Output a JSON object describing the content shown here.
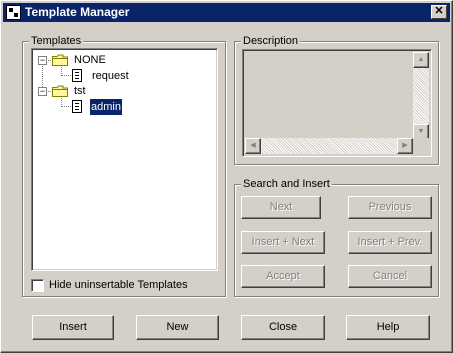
{
  "window": {
    "title": "Template Manager",
    "close_glyph": "✕",
    "icon": "template-manager-icon"
  },
  "templates": {
    "group_label": "Templates",
    "tree": [
      {
        "label": "NONE",
        "type": "folder",
        "expanded": true,
        "children": [
          {
            "label": "request",
            "type": "document"
          }
        ]
      },
      {
        "label": "tst",
        "type": "folder",
        "expanded": true,
        "children": [
          {
            "label": "admin",
            "type": "document",
            "selected": true
          }
        ]
      }
    ],
    "expander_symbol": "−",
    "hide_checkbox_label": "Hide uninsertable Templates",
    "hide_checkbox_checked": false
  },
  "description": {
    "group_label": "Description",
    "text": ""
  },
  "search": {
    "group_label": "Search and Insert",
    "next": "Next",
    "previous": "Previous",
    "insert_next": "Insert + Next",
    "insert_prev": "Insert + Prev.",
    "accept": "Accept",
    "cancel": "Cancel"
  },
  "buttons": {
    "insert": "Insert",
    "new": "New",
    "close": "Close",
    "help": "Help"
  },
  "colors": {
    "face": "#d4d0c8",
    "titlebar": "#0a246a",
    "selection": "#0a246a",
    "disabled_text": "#808080"
  }
}
